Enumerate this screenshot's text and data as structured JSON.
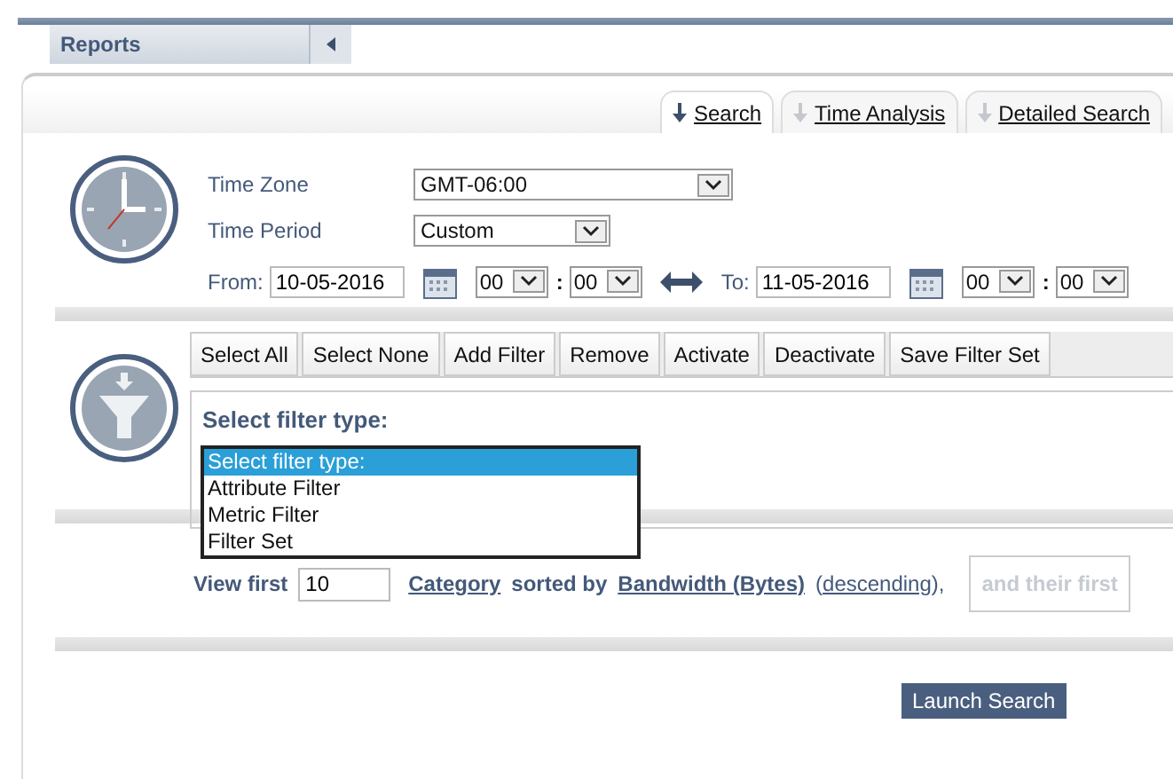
{
  "sidebar": {
    "title": "Reports"
  },
  "tabs": [
    {
      "label": "Search",
      "selected": true
    },
    {
      "label": "Time Analysis",
      "selected": false
    },
    {
      "label": "Detailed Search",
      "selected": false
    }
  ],
  "time": {
    "zone_label": "Time Zone",
    "zone": "GMT-06:00",
    "period_label": "Time Period",
    "period": "Custom",
    "from_label": "From:",
    "from_date": "10-05-2016",
    "from_hour": "00",
    "from_min": "00",
    "to_label": "To:",
    "to_date": "11-05-2016",
    "to_hour": "00",
    "to_min": "00",
    "sep": ":"
  },
  "filter_buttons": [
    "Select All",
    "Select None",
    "Add Filter",
    "Remove",
    "Activate",
    "Deactivate",
    "Save Filter Set"
  ],
  "filter_heading": "Select filter type:",
  "filter_options": [
    {
      "label": "Select filter type:",
      "selected": true
    },
    {
      "label": "Attribute Filter",
      "selected": false
    },
    {
      "label": "Metric Filter",
      "selected": false
    },
    {
      "label": "Filter Set",
      "selected": false
    }
  ],
  "view": {
    "label": "View first",
    "count": "10",
    "category": "Category",
    "sorted_by": "sorted by",
    "metric": "Bandwidth (Bytes)",
    "open_paren": "(",
    "order": "descending",
    "close_paren": "),",
    "extra": "and their first"
  },
  "launch_button": "Launch Search"
}
